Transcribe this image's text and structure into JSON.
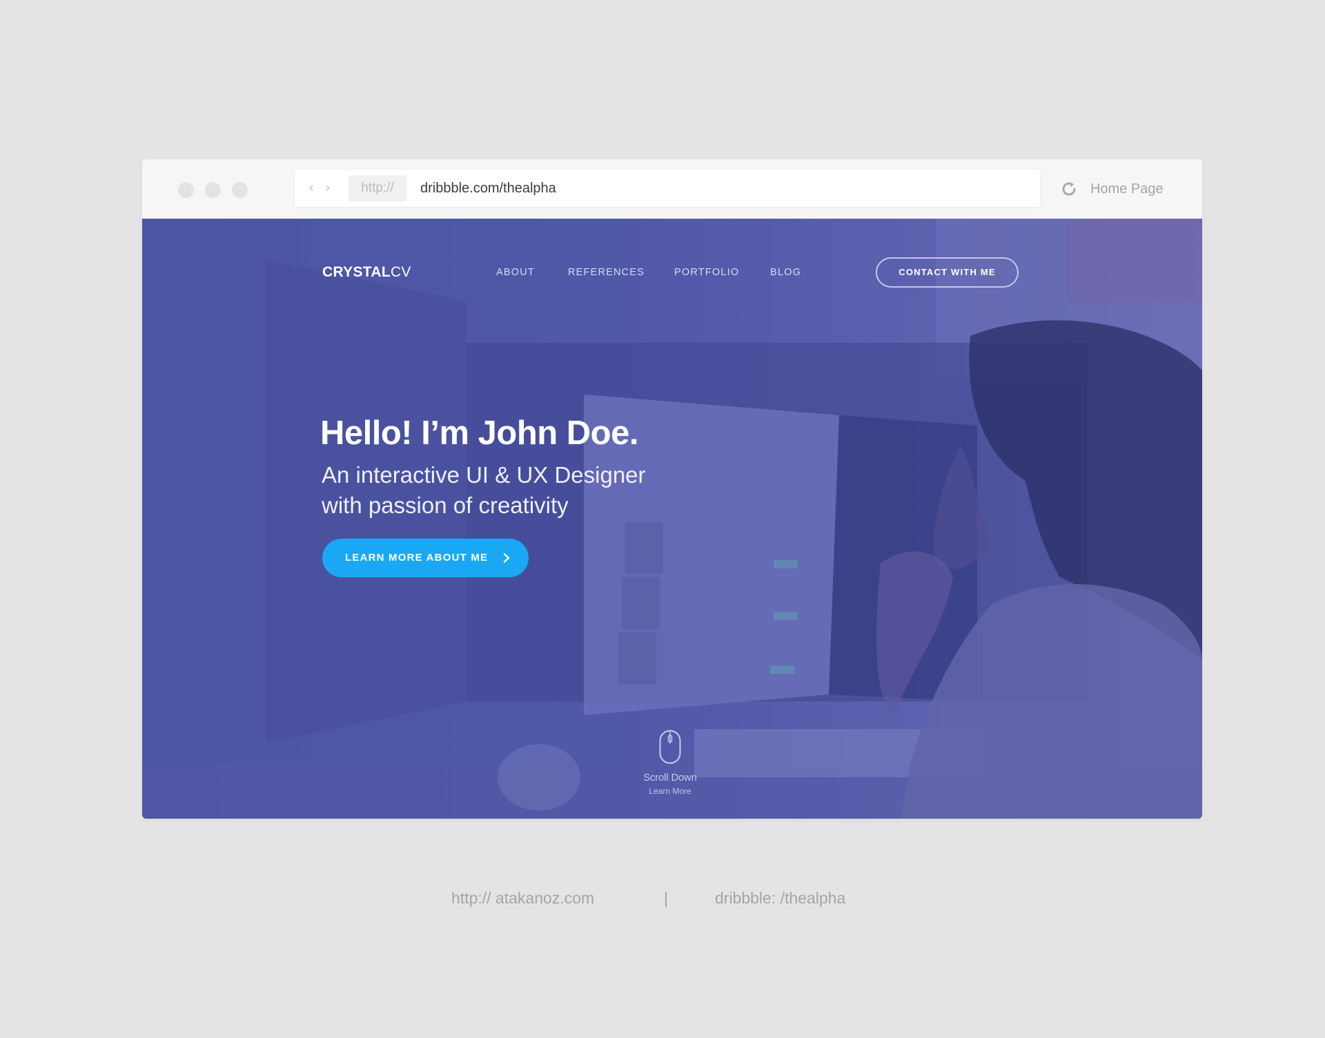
{
  "browser": {
    "protocol": "http://",
    "url": "dribbble.com/thealpha",
    "home_label": "Home Page"
  },
  "site": {
    "logo_bold": "CRYSTAL",
    "logo_light": "CV",
    "nav": [
      "ABOUT",
      "REFERENCES",
      "PORTFOLIO",
      "BLOG"
    ],
    "contact_label": "CONTACT WITH ME"
  },
  "hero": {
    "title": "Hello! I’m John Doe.",
    "subtitle_line1": "An interactive UI & UX Designer",
    "subtitle_line2": "with passion of creativity",
    "cta_label": "LEARN MORE ABOUT ME",
    "scroll_label": "Scroll Down",
    "scroll_sub": "Learn More"
  },
  "footer": {
    "left": "http:// atakanoz.com",
    "separator": "|",
    "right": "dribbble: /thealpha"
  },
  "colors": {
    "page_bg": "#e4e4e4",
    "hero_overlay": "#5058a8",
    "cta": "#1aa8f5"
  }
}
